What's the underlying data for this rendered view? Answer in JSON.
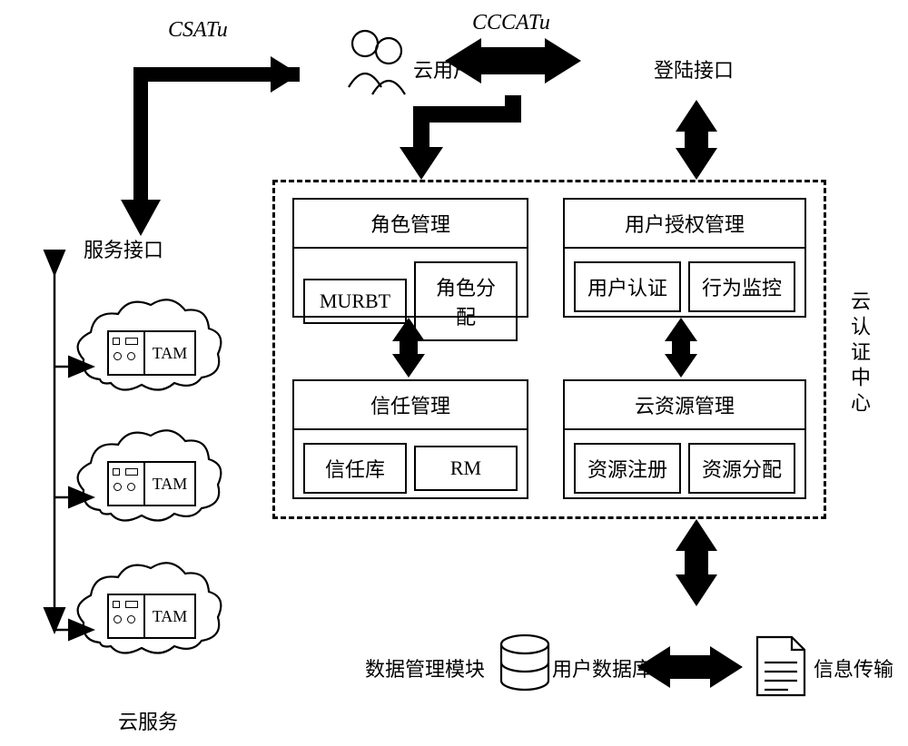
{
  "labels": {
    "csatuu": "CSATu",
    "cccatu": "CCCATu",
    "cloudUser": "云用户",
    "loginInterface": "登陆接口",
    "serviceInterface": "服务接口",
    "cloudService": "云服务",
    "authCenter": "云认证中心",
    "dataMgmtModule": "数据管理模块",
    "userDb": "用户数据库",
    "infoTransfer": "信息传输",
    "tam": "TAM"
  },
  "modules": {
    "roleMgmt": {
      "title": "角色管理",
      "sub1": "MURBT",
      "sub2": "角色分配"
    },
    "userAuthMgmt": {
      "title": "用户授权管理",
      "sub1": "用户认证",
      "sub2": "行为监控"
    },
    "trustMgmt": {
      "title": "信任管理",
      "sub1": "信任库",
      "sub2": "RM"
    },
    "cloudResMgmt": {
      "title": "云资源管理",
      "sub1": "资源注册",
      "sub2": "资源分配"
    }
  }
}
